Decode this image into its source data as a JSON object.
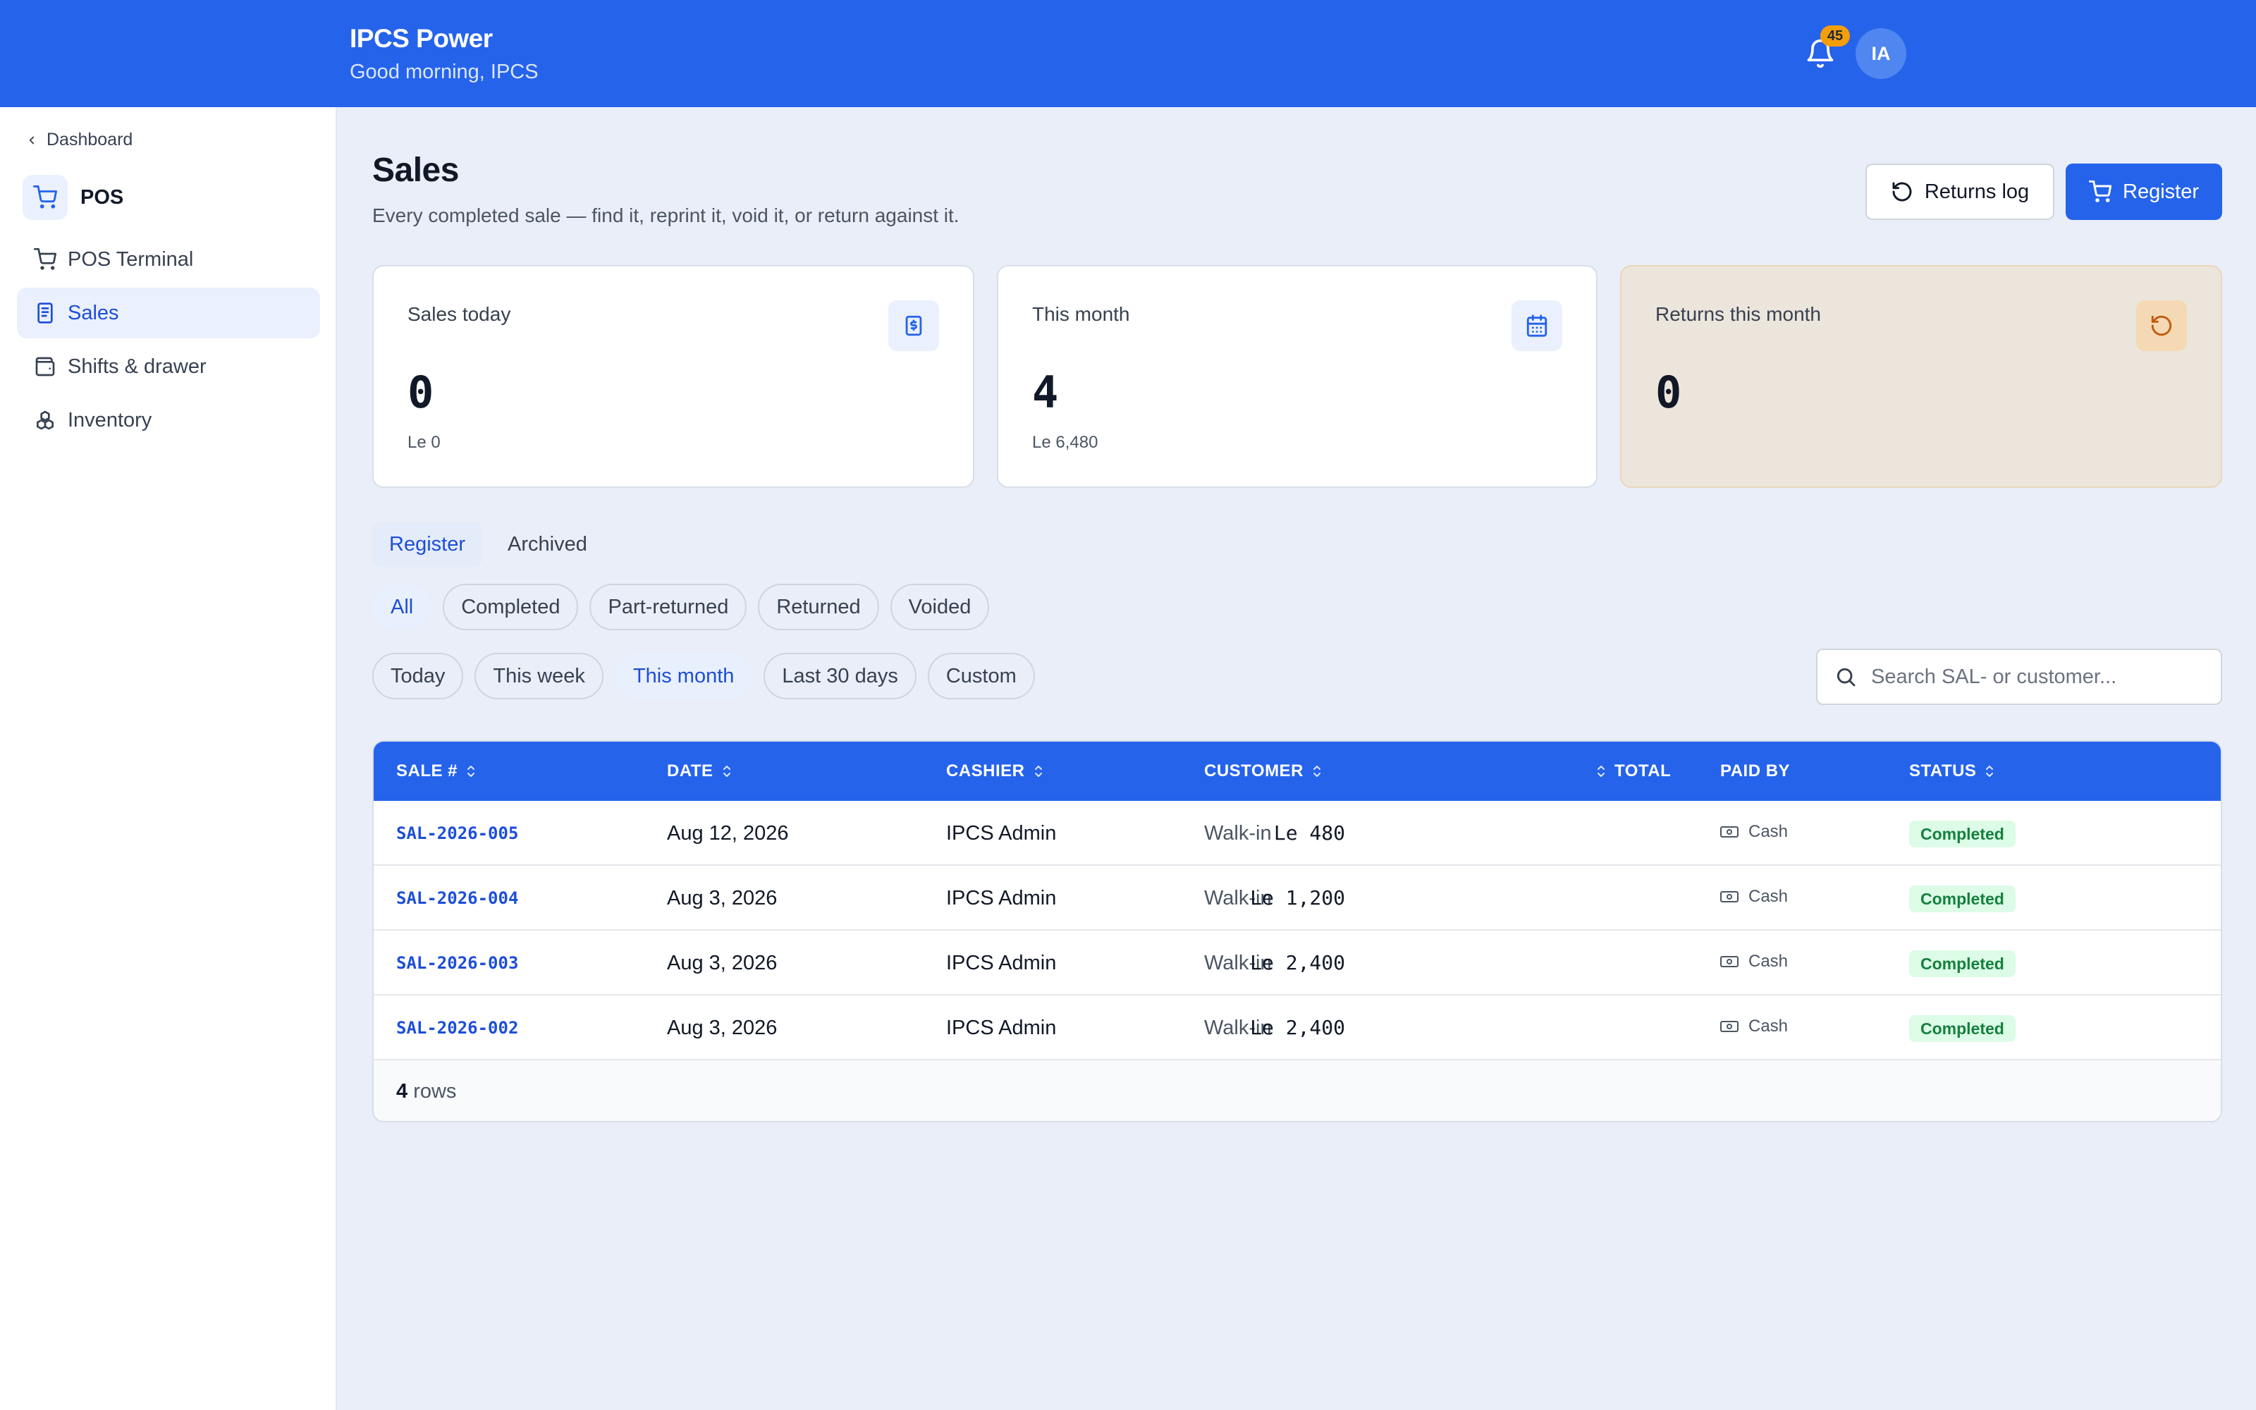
{
  "header": {
    "brand": "IPCS Power",
    "greeting": "Good morning, IPCS",
    "notification_count": "45",
    "avatar_initials": "IA"
  },
  "sidebar": {
    "back_label": "Dashboard",
    "module_label": "POS",
    "items": [
      {
        "label": "POS Terminal",
        "icon": "cart-icon"
      },
      {
        "label": "Sales",
        "icon": "receipt-icon",
        "active": true
      },
      {
        "label": "Shifts & drawer",
        "icon": "wallet-icon"
      },
      {
        "label": "Inventory",
        "icon": "boxes-icon"
      }
    ]
  },
  "page": {
    "title": "Sales",
    "subtitle": "Every completed sale — find it, reprint it, void it, or return against it.",
    "returns_log_label": "Returns log",
    "register_label": "Register"
  },
  "cards": [
    {
      "label": "Sales today",
      "value": "0",
      "sub": "Le 0",
      "icon": "receipt-dollar-icon"
    },
    {
      "label": "This month",
      "value": "4",
      "sub": "Le 6,480",
      "icon": "calendar-icon"
    },
    {
      "label": "Returns this month",
      "value": "0",
      "sub": "",
      "icon": "undo-icon"
    }
  ],
  "tabs": [
    {
      "label": "Register",
      "active": true
    },
    {
      "label": "Archived",
      "active": false
    }
  ],
  "status_filters": [
    "All",
    "Completed",
    "Part-returned",
    "Returned",
    "Voided"
  ],
  "status_filter_selected": "All",
  "date_filters": [
    "Today",
    "This week",
    "This month",
    "Last 30 days",
    "Custom"
  ],
  "date_filter_selected": "This month",
  "search": {
    "placeholder": "Search SAL- or customer...",
    "value": ""
  },
  "table": {
    "columns": {
      "sale": "SALE #",
      "date": "DATE",
      "cashier": "CASHIER",
      "customer": "CUSTOMER",
      "total": "TOTAL",
      "paid_by": "PAID BY",
      "status": "STATUS"
    },
    "rows": [
      {
        "sale": "SAL-2026-005",
        "date": "Aug 12, 2026",
        "cashier": "IPCS Admin",
        "customer": "Walk-in",
        "total": "Le 480",
        "paid_by": "Cash",
        "status": "Completed"
      },
      {
        "sale": "SAL-2026-004",
        "date": "Aug 3, 2026",
        "cashier": "IPCS Admin",
        "customer": "Walk-in",
        "total": "Le 1,200",
        "paid_by": "Cash",
        "status": "Completed"
      },
      {
        "sale": "SAL-2026-003",
        "date": "Aug 3, 2026",
        "cashier": "IPCS Admin",
        "customer": "Walk-in",
        "total": "Le 2,400",
        "paid_by": "Cash",
        "status": "Completed"
      },
      {
        "sale": "SAL-2026-002",
        "date": "Aug 3, 2026",
        "cashier": "IPCS Admin",
        "customer": "Walk-in",
        "total": "Le 2,400",
        "paid_by": "Cash",
        "status": "Completed"
      }
    ],
    "footer_count": "4",
    "footer_label": "rows"
  },
  "colors": {
    "primary": "#2563eb",
    "background": "#e9eef8",
    "success_bg": "#dcfce7",
    "success_text": "#15803d",
    "warning": "#f59e0b"
  }
}
